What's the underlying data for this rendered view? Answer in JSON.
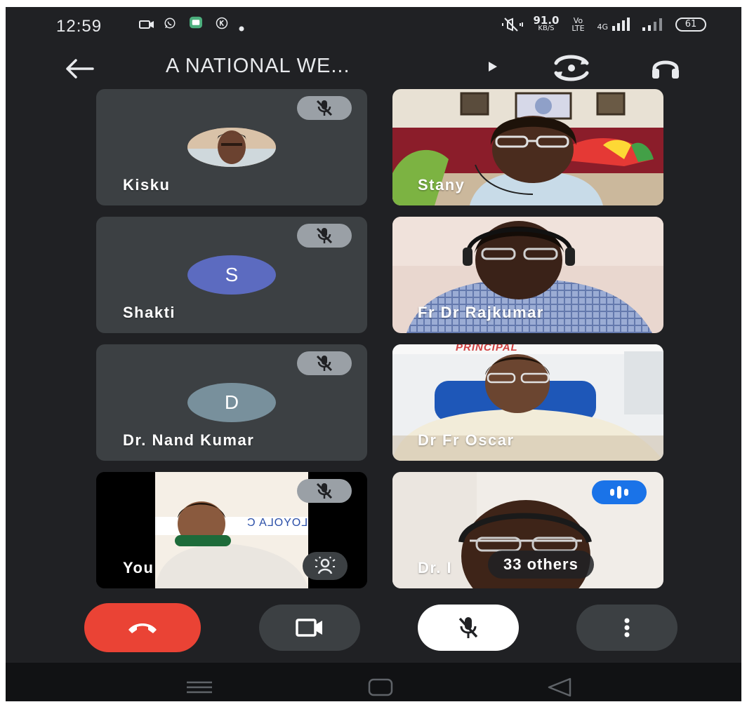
{
  "status_bar": {
    "time": "12:59",
    "net_speed": "91.0",
    "net_unit": "KB/S",
    "volte": "Vo LTE",
    "net_type": "4G",
    "battery": "61"
  },
  "meeting": {
    "title": "A NATIONAL WE..."
  },
  "participants": [
    {
      "name": "Kisku",
      "type": "photo-avatar",
      "muted": true
    },
    {
      "name": "Stany",
      "type": "video",
      "muted": false
    },
    {
      "name": "Shakti",
      "type": "letter-avatar",
      "initial": "S",
      "color": "#5c6bc0",
      "muted": true
    },
    {
      "name": "Fr Dr Rajkumar",
      "type": "video",
      "muted": false
    },
    {
      "name": "Dr. Nand Kumar",
      "type": "letter-avatar",
      "initial": "D",
      "color": "#78909c",
      "muted": true
    },
    {
      "name": "Dr Fr Oscar",
      "type": "video",
      "muted": false,
      "sign_text": "PRINCIPAL"
    },
    {
      "name": "You",
      "type": "self-video",
      "muted": true,
      "banner_text": "LOYOLA C"
    },
    {
      "name": "Dr. I",
      "type": "video",
      "speaking": true
    }
  ],
  "others_label": "33 others",
  "controls": {
    "end_call_color": "#ea4335",
    "camera_on": true,
    "mic_muted": true
  },
  "colors": {
    "background": "#202124",
    "tile": "#3c4043",
    "accent_blue": "#1a73e8",
    "end_red": "#ea4335"
  }
}
